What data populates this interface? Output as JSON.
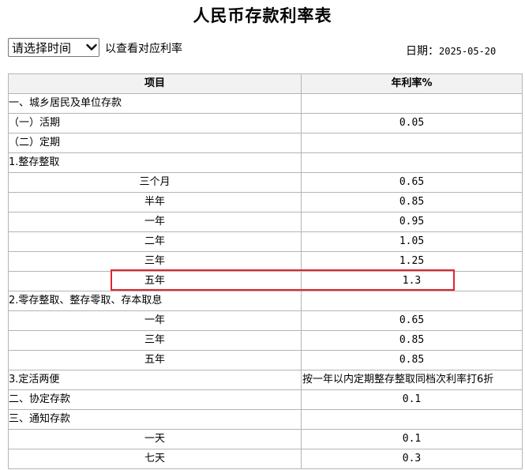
{
  "page": {
    "title": "人民币存款利率表"
  },
  "filter": {
    "selected_option": "请选择时间",
    "hint": "以查看对应利率",
    "date_label": "日期：",
    "date_value": "2025-05-20"
  },
  "table": {
    "headers": {
      "item": "项目",
      "rate": "年利率%"
    },
    "rows": [
      {
        "item": "一、城乡居民及单位存款",
        "rate": ""
      },
      {
        "item": "（一）活期",
        "rate": "0.05"
      },
      {
        "item": "（二）定期",
        "rate": ""
      },
      {
        "item": "1.整存整取",
        "rate": ""
      },
      {
        "item": "三个月",
        "rate": "0.65"
      },
      {
        "item": "半年",
        "rate": "0.85"
      },
      {
        "item": "一年",
        "rate": "0.95"
      },
      {
        "item": "二年",
        "rate": "1.05"
      },
      {
        "item": "三年",
        "rate": "1.25"
      },
      {
        "item": "五年",
        "rate": "1.3"
      },
      {
        "item": "2.零存整取、整存零取、存本取息",
        "rate": ""
      },
      {
        "item": "一年",
        "rate": "0.65"
      },
      {
        "item": "三年",
        "rate": "0.85"
      },
      {
        "item": "五年",
        "rate": "0.85"
      },
      {
        "item": "3.定活两便",
        "rate": "按一年以内定期整存整取同档次利率打6折"
      },
      {
        "item": "二、协定存款",
        "rate": "0.1"
      },
      {
        "item": "三、通知存款",
        "rate": ""
      },
      {
        "item": "一天",
        "rate": "0.1"
      },
      {
        "item": "七天",
        "rate": "0.3"
      }
    ]
  },
  "colors": {
    "highlight": "#e0262b",
    "grid": "#b5b5b5",
    "header_bg": "#f2f2f2"
  },
  "icons": {
    "dropdown": "chevron-down-icon"
  }
}
